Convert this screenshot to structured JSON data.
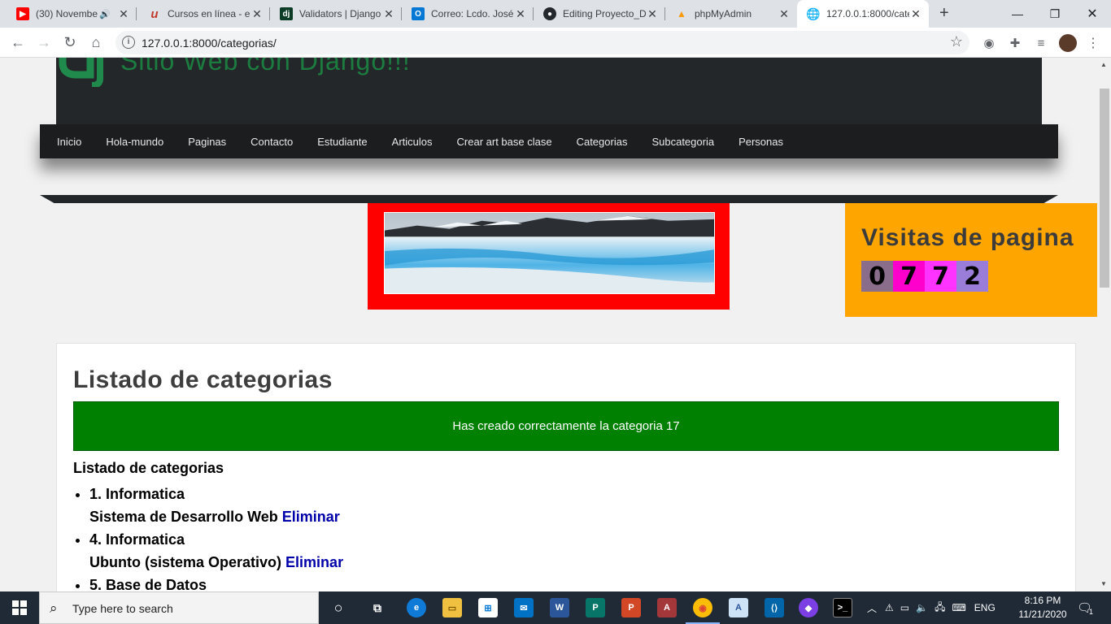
{
  "browser": {
    "tabs": [
      {
        "title": "(30) Novembe",
        "icon": "youtube-icon",
        "color": "#ff0000"
      },
      {
        "title": "Cursos en línea - e",
        "icon": "udemy-icon",
        "color": "#a435f0"
      },
      {
        "title": "Validators | Django",
        "icon": "django-icon",
        "color": "#0c3c26"
      },
      {
        "title": "Correo: Lcdo. José",
        "icon": "outlook-icon",
        "color": "#0078d4"
      },
      {
        "title": "Editing Proyecto_D",
        "icon": "github-icon",
        "color": "#24292e"
      },
      {
        "title": "phpMyAdmin",
        "icon": "phpmyadmin-icon",
        "color": "#f89c0e"
      },
      {
        "title": "127.0.0.1:8000/cate",
        "icon": "globe-icon",
        "color": "#5f6368",
        "active": true
      }
    ],
    "url": "127.0.0.1:8000/categorias/"
  },
  "site": {
    "title": "Sitio Web con Django!!!",
    "menu": [
      "Inicio",
      "Hola-mundo",
      "Paginas",
      "Contacto",
      "Estudiante",
      "Articulos",
      "Crear art base clase",
      "Categorias",
      "Subcategoria",
      "Personas"
    ],
    "visits": {
      "heading": "Visitas de pagina",
      "digits": [
        "0",
        "7",
        "7",
        "2"
      ]
    }
  },
  "main": {
    "heading": "Listado de categorias",
    "alert": "Has creado correctamente la categoria 17",
    "list_title": "Listado de categorias",
    "items": [
      {
        "name": "1. Informatica",
        "desc": "Sistema de Desarrollo Web",
        "action": "Eliminar"
      },
      {
        "name": "4. Informatica",
        "desc": "Ubunto (sistema Operativo)",
        "action": "Eliminar"
      },
      {
        "name": "5. Base de Datos",
        "desc": "",
        "action": ""
      }
    ]
  },
  "taskbar": {
    "search_placeholder": "Type here to search",
    "language": "ENG",
    "time": "8:16 PM",
    "date": "11/21/2020",
    "notifications": "1"
  }
}
